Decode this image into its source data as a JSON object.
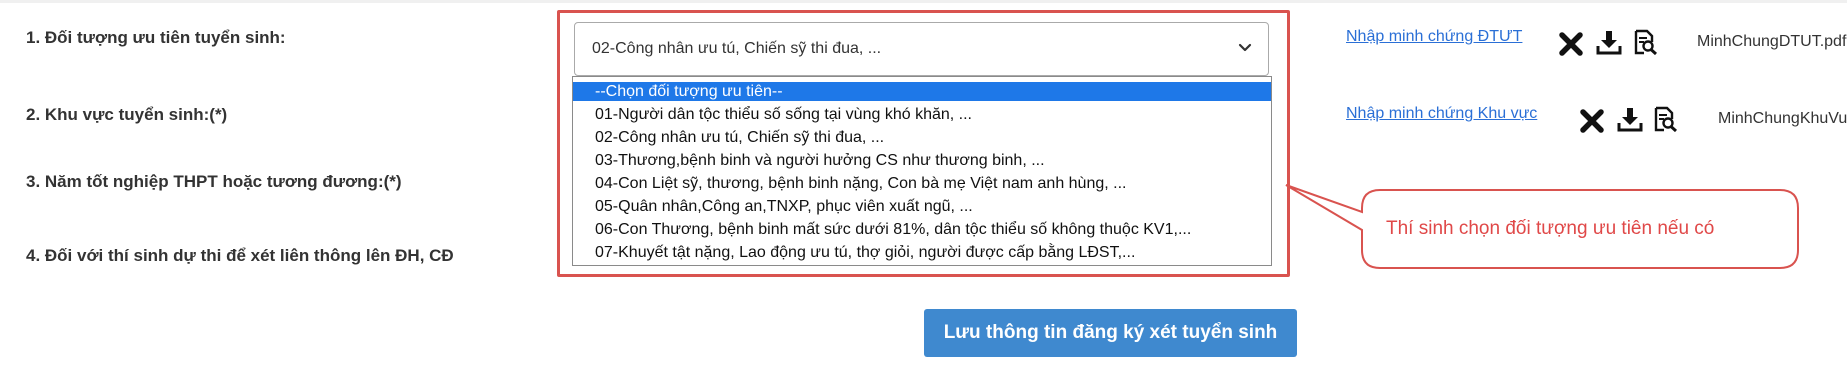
{
  "form": {
    "fields": [
      {
        "label": "1. Đối tượng ưu tiên tuyển sinh:"
      },
      {
        "label": "2. Khu vực tuyển sinh:(*)"
      },
      {
        "label": "3. Năm tốt nghiệp THPT hoặc tương đương:(*)"
      },
      {
        "label": "4. Đối với thí sinh dự thi để xét liên thông lên ĐH, CĐ"
      }
    ]
  },
  "priority_select": {
    "value": "02-Công nhân ưu tú, Chiến sỹ thi đua, ...",
    "options": [
      "--Chọn đối tượng ưu tiên--",
      "01-Người dân tộc thiểu số sống tại vùng khó khăn, ...",
      "02-Công nhân ưu tú, Chiến sỹ thi đua, ...",
      "03-Thương,bệnh binh và người hưởng CS như thương binh, ...",
      "04-Con Liệt sỹ, thương, bệnh binh nặng, Con bà mẹ Việt nam anh hùng, ...",
      "05-Quân nhân,Công an,TNXP, phục viên xuất ngũ, ...",
      "06-Con Thương, bệnh binh mất sức dưới 81%, dân tộc thiểu số không thuộc KV1,...",
      "07-Khuyết tật nặng, Lao động ưu tú, thợ giỏi, người được cấp bằng LĐST,..."
    ],
    "highlighted_index": 0
  },
  "evidence": [
    {
      "link": "Nhập minh chứng ĐTƯT",
      "file": "MinhChungDTUT.pdf"
    },
    {
      "link": "Nhập minh chứng Khu vực",
      "file": "MinhChungKhuVuc.pdf"
    }
  ],
  "callout": {
    "text": "Thí sinh chọn đối tượng ưu tiên nếu có",
    "color": "#e04848"
  },
  "save_button": {
    "label": "Lưu thông tin đăng ký xét tuyển sinh",
    "color": "#3f89cf"
  },
  "icons": {
    "delete": "close-icon",
    "download": "download-icon",
    "view": "document-search-icon"
  }
}
